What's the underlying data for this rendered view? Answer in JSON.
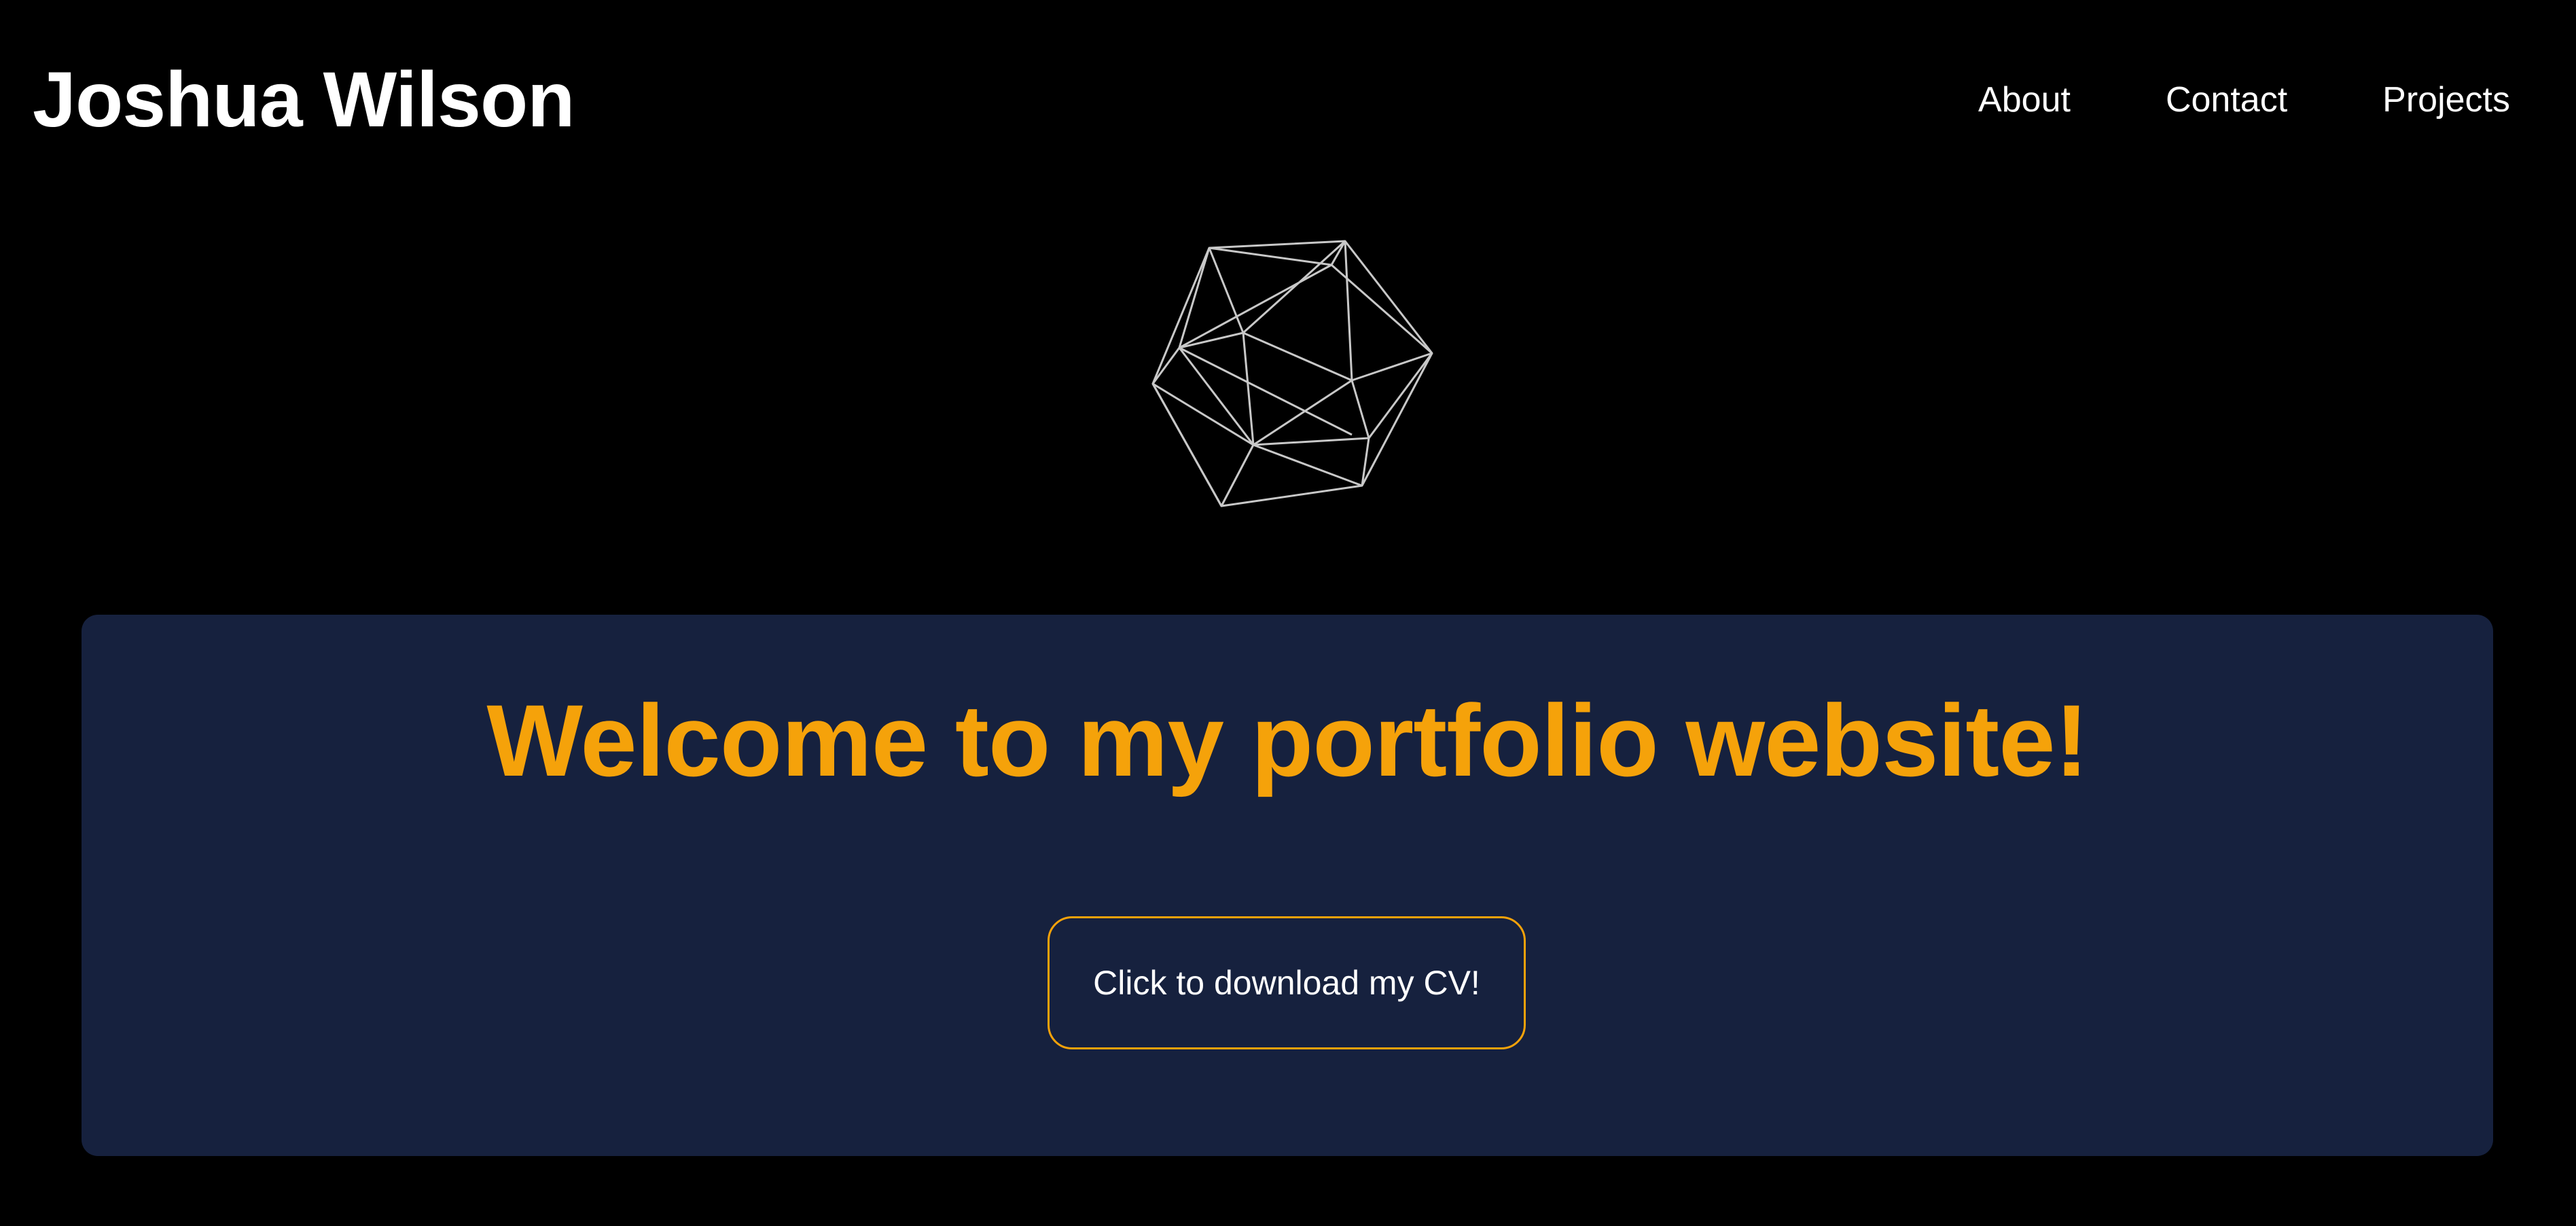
{
  "header": {
    "title": "Joshua Wilson",
    "nav": [
      {
        "label": "About"
      },
      {
        "label": "Contact"
      },
      {
        "label": "Projects"
      }
    ]
  },
  "decoration": {
    "icon": "wireframe-icosahedron-icon",
    "stroke_color": "#c8c8c8"
  },
  "hero": {
    "heading": "Welcome to my portfolio website!",
    "button_label": "Click to download my CV!"
  },
  "colors": {
    "background": "#000000",
    "panel": "#16213e",
    "accent": "#f5a20a",
    "text": "#ffffff"
  }
}
